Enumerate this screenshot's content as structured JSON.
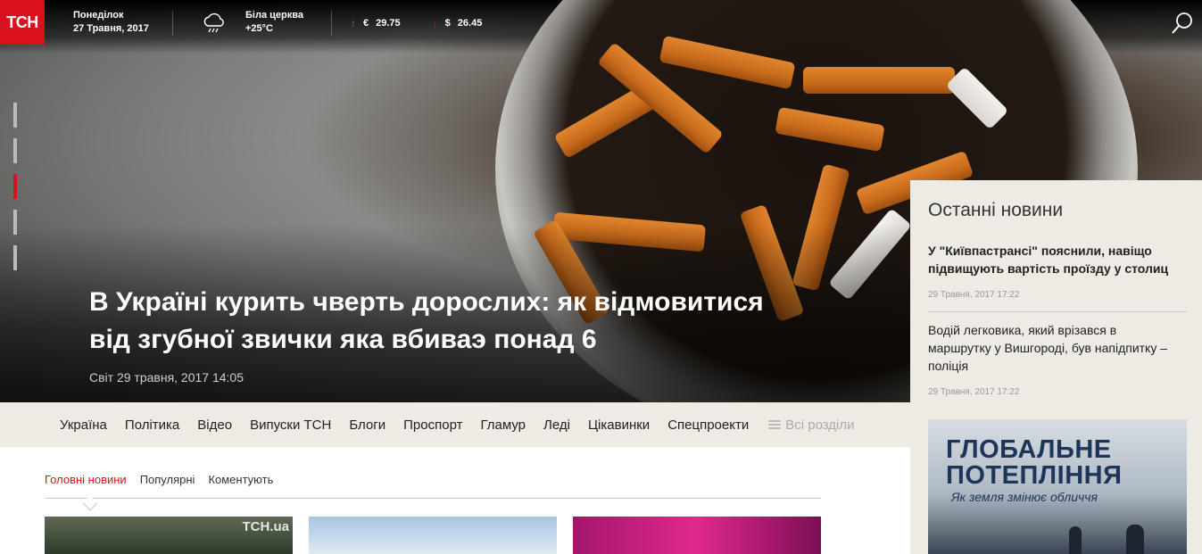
{
  "topbar": {
    "logo": "ТСН",
    "day": "Понеділок",
    "date": "27 Травня, 2017",
    "city": "Біла церква",
    "temperature": "+25°C",
    "eur_symbol": "€",
    "eur_rate": "29.75",
    "usd_symbol": "$",
    "usd_rate": "26.45",
    "colors": {
      "brand": "#d8111d",
      "rate_up": "#2ea44f",
      "rate_down": "#d8111d"
    }
  },
  "hero": {
    "title_line1": "В Україні курить чверть дорослих: як відмовитися",
    "title_line2": "від згубної звички яка вбиваэ понад 6",
    "meta": "Світ 29 травня, 2017 14:05",
    "slides": 5,
    "active_slide": 3
  },
  "nav": {
    "items": [
      "Україна",
      "Політика",
      "Відео",
      "Випуски ТСН",
      "Блоги",
      "Проспорт",
      "Гламур",
      "Леді",
      "Цікавинки",
      "Спецпроекти"
    ],
    "all": "Всі розділи"
  },
  "tabs": [
    {
      "label": "Головні новини",
      "active": true
    },
    {
      "label": "Популярні",
      "active": false
    },
    {
      "label": "Коментують",
      "active": false
    }
  ],
  "thumbs": [
    {
      "watermark": "ТСН.ua"
    }
  ],
  "sidebar": {
    "title": "Останні новини",
    "news": [
      {
        "text": "У \"Київпастрансі\" пояснили, навіщо підвищують вартість проїзду у столиц",
        "time": "29 Травня, 2017 17:22"
      },
      {
        "text": "Водій легковика, який врізався в маршрутку у Вишгороді, був напідпитку – поліція",
        "time": "29 Травня, 2017 17:22"
      }
    ],
    "promo": {
      "line1": "ГЛОБАЛЬНЕ",
      "line2": "ПОТЕПЛІННЯ",
      "sub": "Як земля змінює обличчя"
    }
  }
}
